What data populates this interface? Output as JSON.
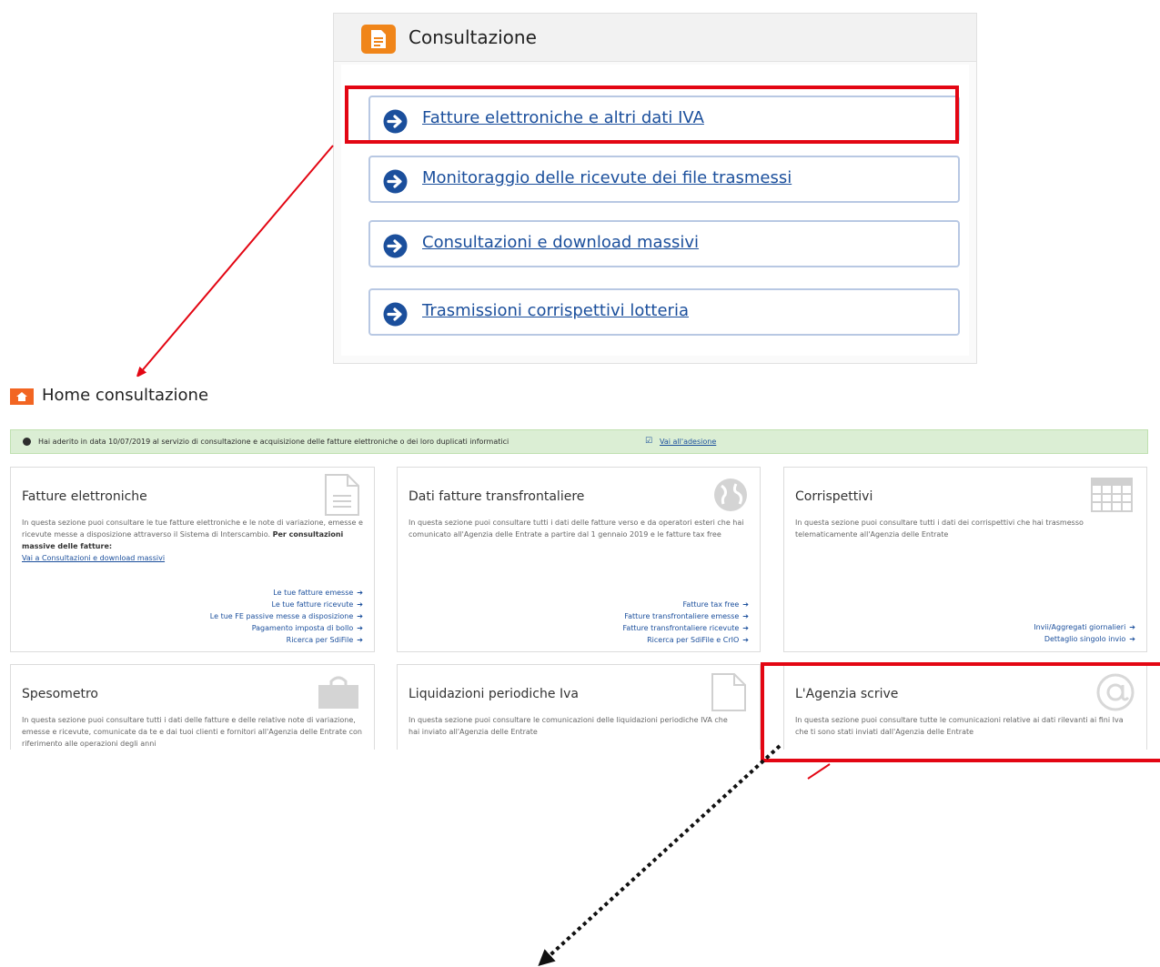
{
  "consultazione": {
    "title": "Consultazione",
    "links": [
      "Fatture elettroniche e altri dati IVA",
      "Monitoraggio delle ricevute dei file trasmessi",
      "Consultazioni e download massivi",
      "Trasmissioni corrispettivi lotteria"
    ]
  },
  "home": {
    "title": "Home consultazione",
    "notice": {
      "text": "Hai aderito in data 10/07/2019 al servizio di consultazione e acquisizione delle fatture elettroniche o dei loro duplicati informatici",
      "link": "Vai all'adesione"
    },
    "cards": [
      {
        "title": "Fatture elettroniche",
        "icon": "document-icon",
        "description": "In questa sezione puoi consultare le tue fatture elettroniche e le note di variazione, emesse e ricevute messe a disposizione attraverso il Sistema di Interscambio.",
        "description_bold": "Per consultazioni massive delle fatture:",
        "description_link": "Vai a Consultazioni e download massivi",
        "links": [
          "Le tue fatture emesse",
          "Le tue fatture ricevute",
          "Le tue FE passive messe a disposizione",
          "Pagamento imposta di bollo",
          "Ricerca per SdiFile"
        ]
      },
      {
        "title": "Dati fatture transfrontaliere",
        "icon": "globe-icon",
        "description": "In questa sezione puoi consultare tutti i dati delle fatture verso e da operatori esteri che hai comunicato all'Agenzia delle Entrate a partire dal 1 gennaio 2019 e le fatture tax free",
        "links": [
          "Fatture tax free",
          "Fatture transfrontaliere emesse",
          "Fatture transfrontaliere ricevute",
          "Ricerca per SdiFile e CrIO"
        ]
      },
      {
        "title": "Corrispettivi",
        "icon": "calculator-icon",
        "description": "In questa sezione puoi consultare tutti i dati dei corrispettivi che hai trasmesso telematicamente all'Agenzia delle Entrate",
        "links": [
          "Invii/Aggregati giornalieri",
          "Dettaglio singolo invio"
        ]
      },
      {
        "title": "Spesometro",
        "icon": "shopping-bag-icon",
        "description": "In questa sezione puoi consultare tutti i dati delle fatture e delle relative note di variazione, emesse e ricevute, comunicate da te e dai tuoi clienti e fornitori all'Agenzia delle Entrate con riferimento alle operazioni degli anni"
      },
      {
        "title": "Liquidazioni periodiche Iva",
        "icon": "blank-page-icon",
        "description": "In questa sezione puoi consultare le comunicazioni delle liquidazioni periodiche IVA che hai inviato all'Agenzia delle Entrate"
      },
      {
        "title": "L'Agenzia scrive",
        "icon": "at-sign-icon",
        "description": "In questa sezione puoi consultare tutte le comunicazioni relative ai dati rilevanti ai fini Iva che ti sono stati inviati dall'Agenzia delle Entrate"
      }
    ]
  },
  "colors": {
    "accent_orange": "#f08519",
    "link_blue": "#1b4f9c",
    "highlight_red": "#e30613",
    "notice_green": "#dbeed4"
  }
}
